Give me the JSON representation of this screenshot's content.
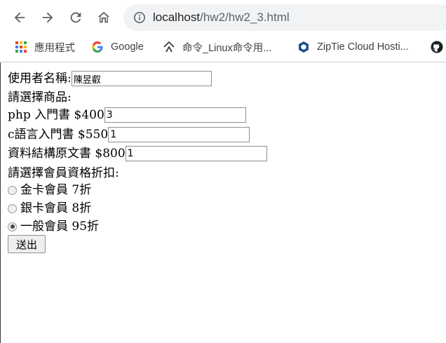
{
  "browser": {
    "url_host": "localhost",
    "url_path": "/hw2/hw2_3.html"
  },
  "bookmarks": [
    {
      "label": "應用程式",
      "icon": "apps-grid-icon"
    },
    {
      "label": "Google",
      "icon": "google-icon"
    },
    {
      "label": "命令_Linux命令用...",
      "icon": "linux-command-icon"
    },
    {
      "label": "ZipTie Cloud Hosti...",
      "icon": "ziptie-icon"
    },
    {
      "label": "",
      "icon": "github-icon"
    }
  ],
  "form": {
    "username_label": "使用者名稱:",
    "username_value": "陳昱叡",
    "products_heading": "請選擇商品:",
    "products": [
      {
        "label": "php 入門書 $400",
        "qty": "3"
      },
      {
        "label": "c語言入門書 $550",
        "qty": "1"
      },
      {
        "label": "資料結構原文書 $800",
        "qty": "1"
      }
    ],
    "discount_heading": "請選擇會員資格折扣:",
    "discounts": [
      {
        "label": "金卡會員 7折",
        "checked": false
      },
      {
        "label": "銀卡會員 8折",
        "checked": false
      },
      {
        "label": "一般會員 95折",
        "checked": true
      }
    ],
    "submit_label": "送出"
  }
}
